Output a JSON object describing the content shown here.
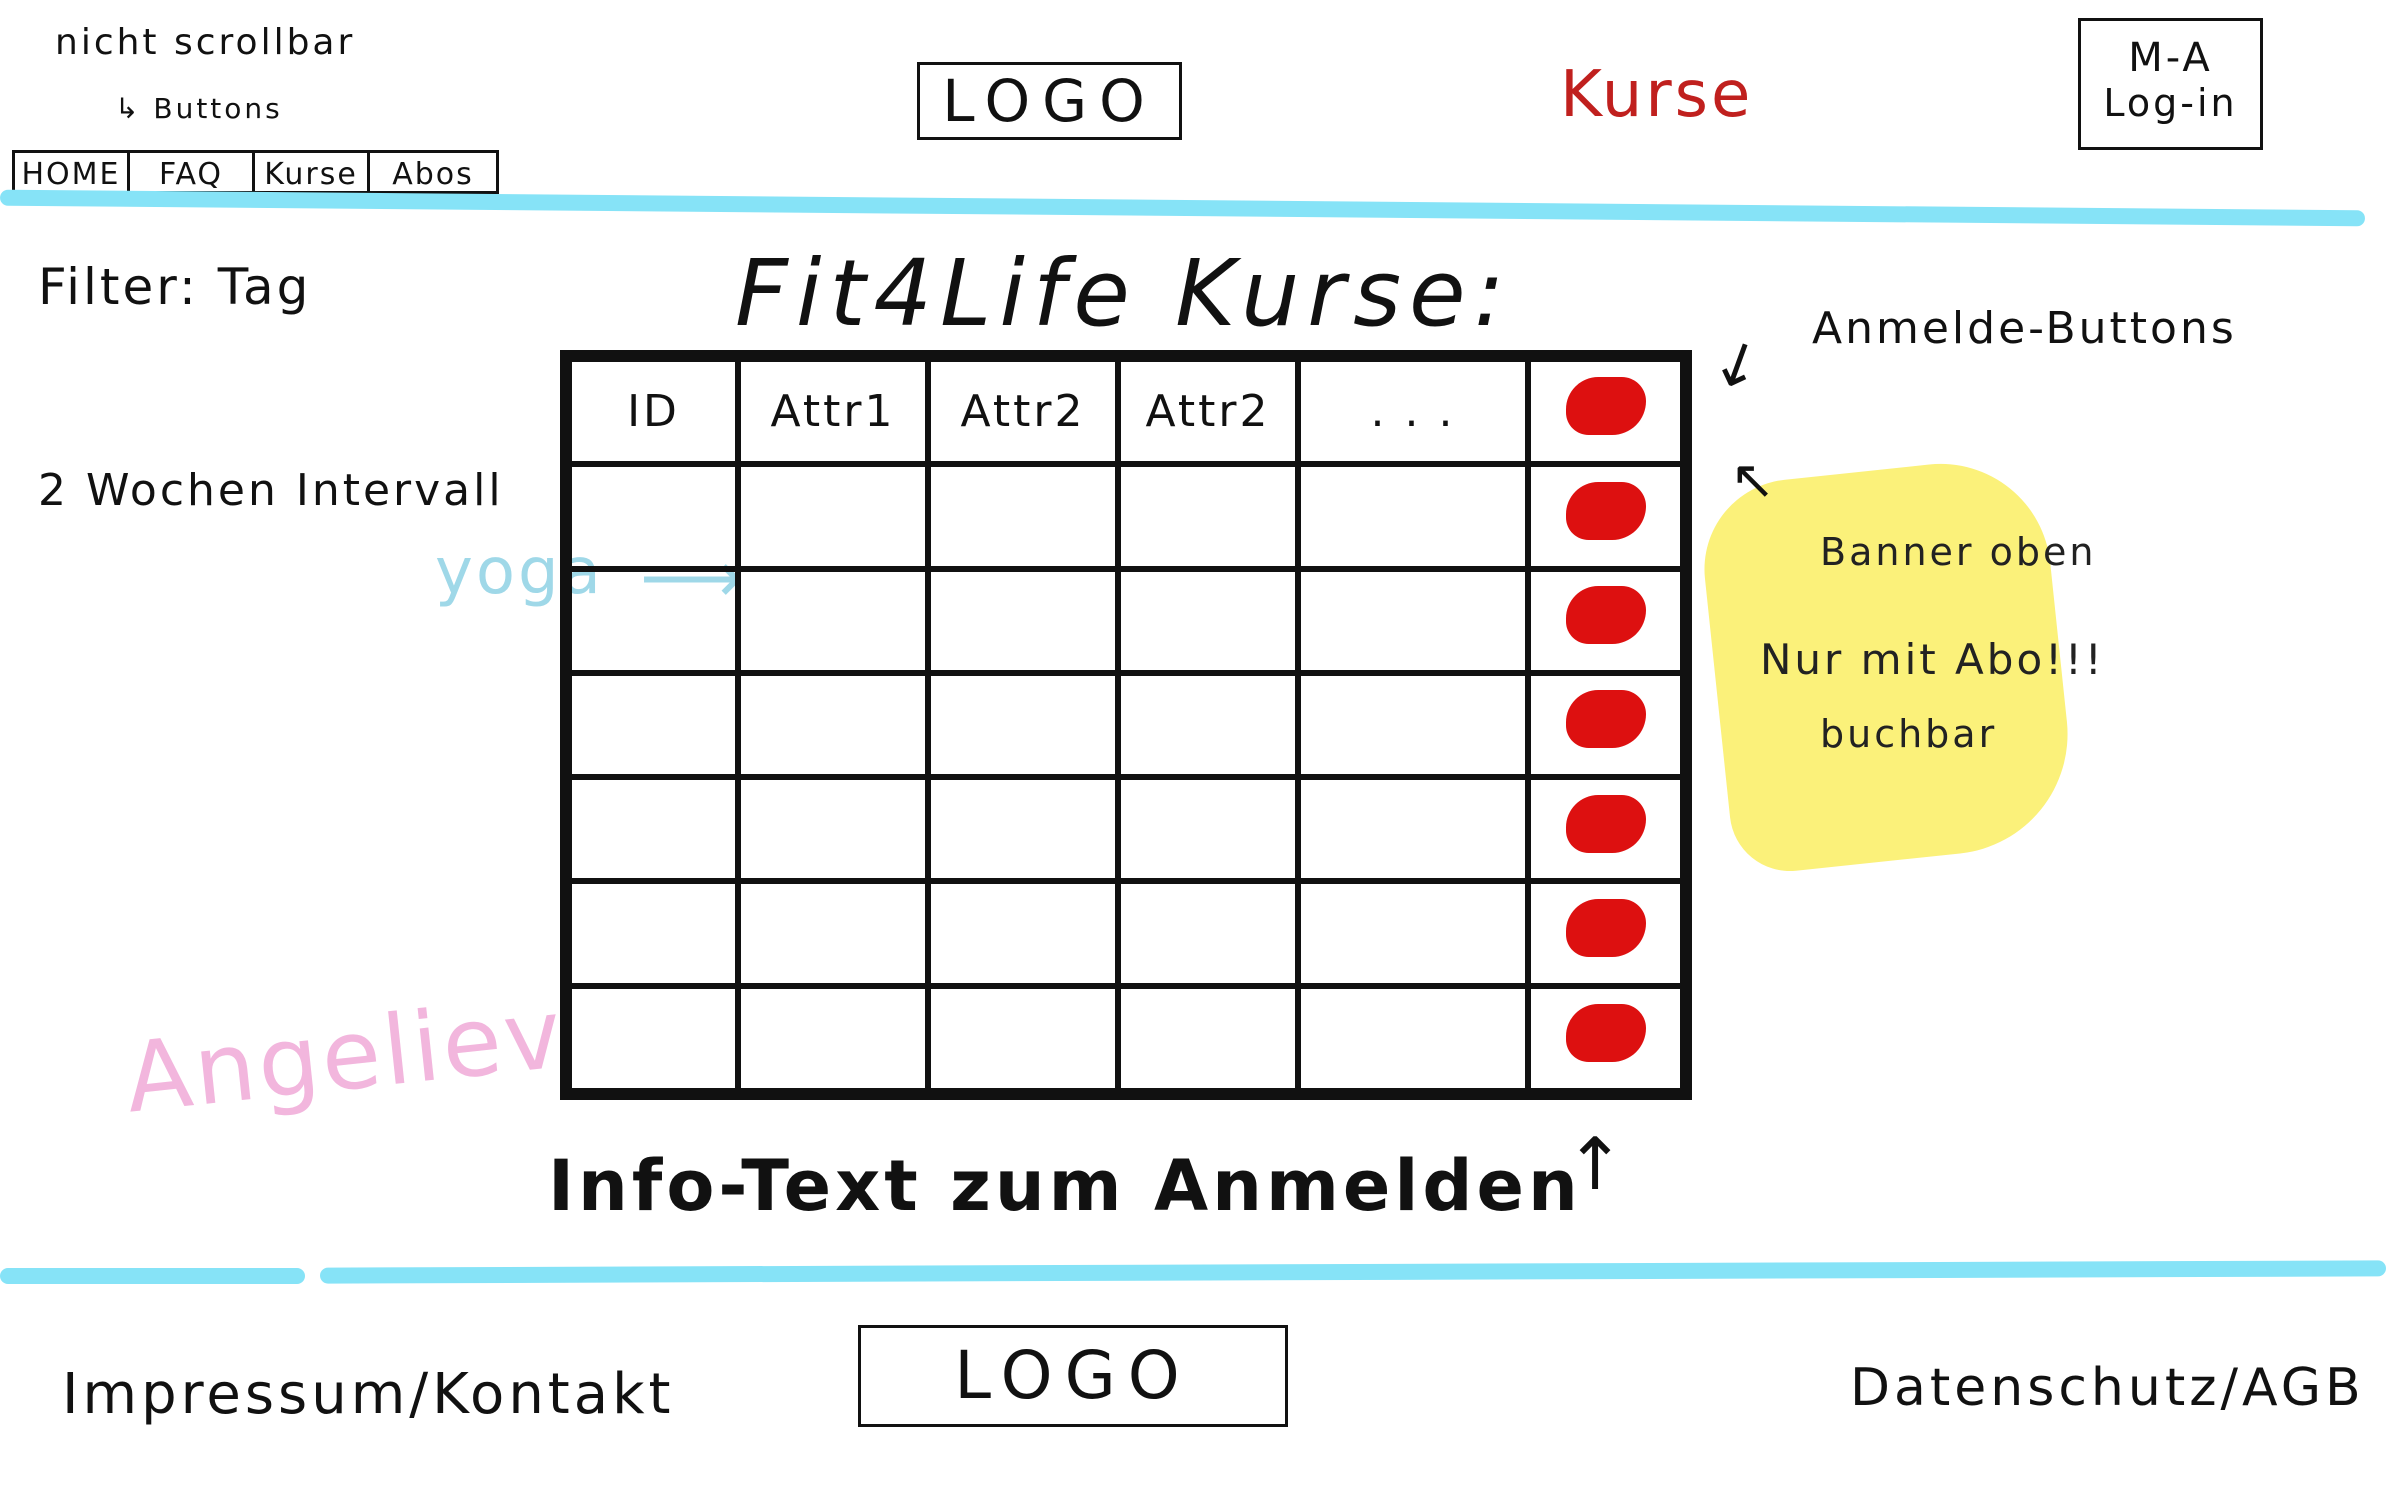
{
  "header": {
    "note_scroll": "nicht scrollbar",
    "note_buttons": "Buttons",
    "nav": [
      {
        "label": "HOME"
      },
      {
        "label": "FAQ"
      },
      {
        "label": "Kurse"
      },
      {
        "label": "Abos"
      }
    ],
    "logo": "LOGO",
    "page_label": "Kurse",
    "login_line1": "M-A",
    "login_line2": "Log-in"
  },
  "main": {
    "filter_label": "Filter: Tag",
    "interval_label": "2 Wochen Intervall",
    "title": "Fit4Life Kurse:",
    "table": {
      "headers": [
        "ID",
        "Attr1",
        "Attr2",
        "Attr2",
        ". . ."
      ],
      "example_cell": "yoga",
      "rows": 6
    },
    "annotation_buttons": "Anmelde-Buttons",
    "banner": {
      "line1": "Banner oben",
      "line2": "Nur mit Abo!!!",
      "line3": "buchbar"
    },
    "info_text": "Info-Text zum Anmelden",
    "signature": "Angeliev"
  },
  "footer": {
    "left": "Impressum/Kontakt",
    "logo": "LOGO",
    "right": "Datenschutz/AGB"
  },
  "colors": {
    "divider": "#86e3f7",
    "register_button": "#dd1010",
    "banner": "#fbf17a",
    "page_label": "#c0201e",
    "yoga": "#9fd8e8",
    "signature": "#f2b6dd"
  }
}
